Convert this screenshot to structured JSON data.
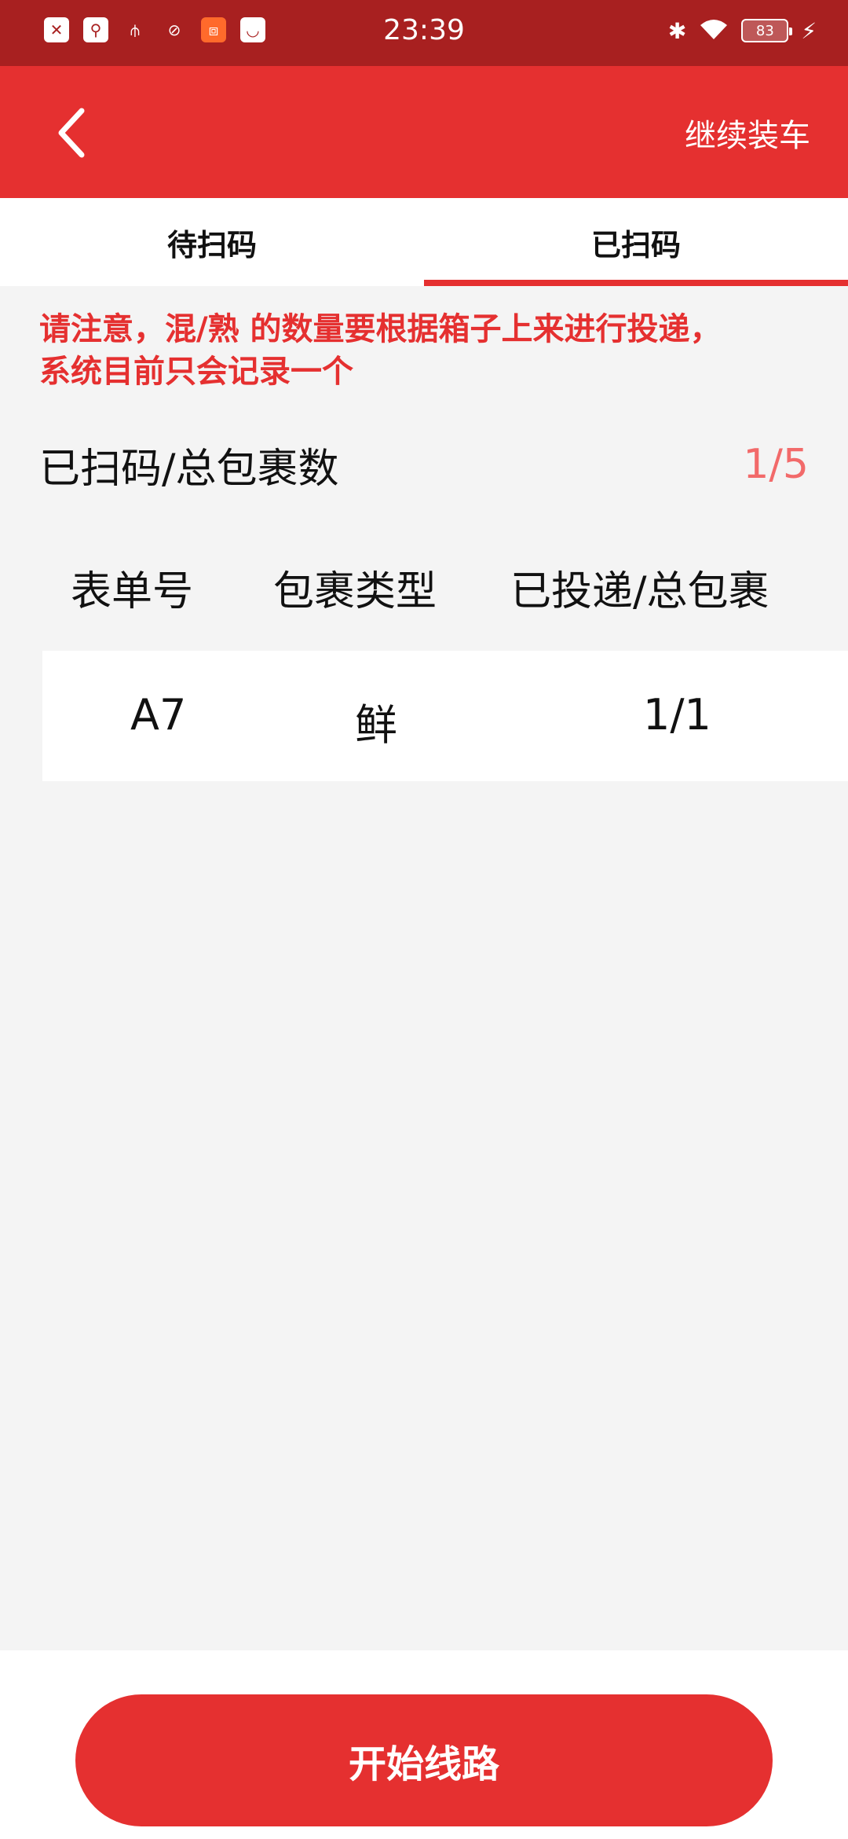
{
  "status_bar": {
    "time": "23:39",
    "battery": "83",
    "left_icons": [
      "sim-card-icon",
      "usb-debug-icon",
      "usb-icon",
      "link-icon",
      "app-orange-icon",
      "shopping-bag-icon"
    ],
    "right_icons": [
      "bluetooth-icon",
      "wifi-icon",
      "battery-icon",
      "charging-icon"
    ]
  },
  "header": {
    "back_icon": "chevron-left-icon",
    "action_label": "继续装车",
    "accent_color": "#e53030"
  },
  "tabs": [
    {
      "label": "待扫码",
      "active": false
    },
    {
      "label": "已扫码",
      "active": true
    }
  ],
  "notice": {
    "line1": "请注意，混/熟 的数量要根据箱子上来进行投递，",
    "line2": "系统目前只会记录一个"
  },
  "summary": {
    "label": "已扫码/总包裹数",
    "value": "1/5"
  },
  "table": {
    "columns": [
      "表单号",
      "包裹类型",
      "已投递/总包裹"
    ],
    "rows": [
      {
        "order_no": "A7",
        "package_type": "鲜",
        "delivered": "1/1"
      }
    ]
  },
  "footer": {
    "button_label": "开始线路"
  }
}
